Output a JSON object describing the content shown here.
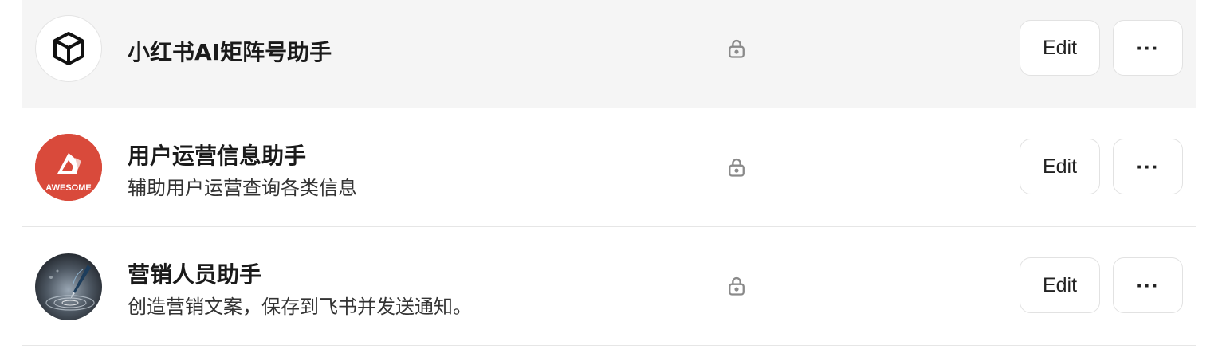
{
  "colors": {
    "hover_row_bg": "#f5f5f5",
    "divider": "#e6e6e6",
    "lock_icon": "#8a8a8a",
    "avatar_red": "#d94a3b"
  },
  "items": [
    {
      "title": "小红书AI矩阵号助手",
      "description": "",
      "avatar_icon": "cube-icon",
      "visibility_icon": "lock-icon",
      "edit_label": "Edit",
      "more_label": "···"
    },
    {
      "title": "用户运营信息助手",
      "description": "辅助用户运营查询各类信息",
      "avatar_icon": "awesome-logo-icon",
      "avatar_text": "AWESOME",
      "visibility_icon": "lock-icon",
      "edit_label": "Edit",
      "more_label": "···"
    },
    {
      "title": "营销人员助手",
      "description": "创造营销文案，保存到飞书并发送通知。",
      "avatar_icon": "fountain-pen-image-icon",
      "visibility_icon": "lock-icon",
      "edit_label": "Edit",
      "more_label": "···"
    }
  ]
}
